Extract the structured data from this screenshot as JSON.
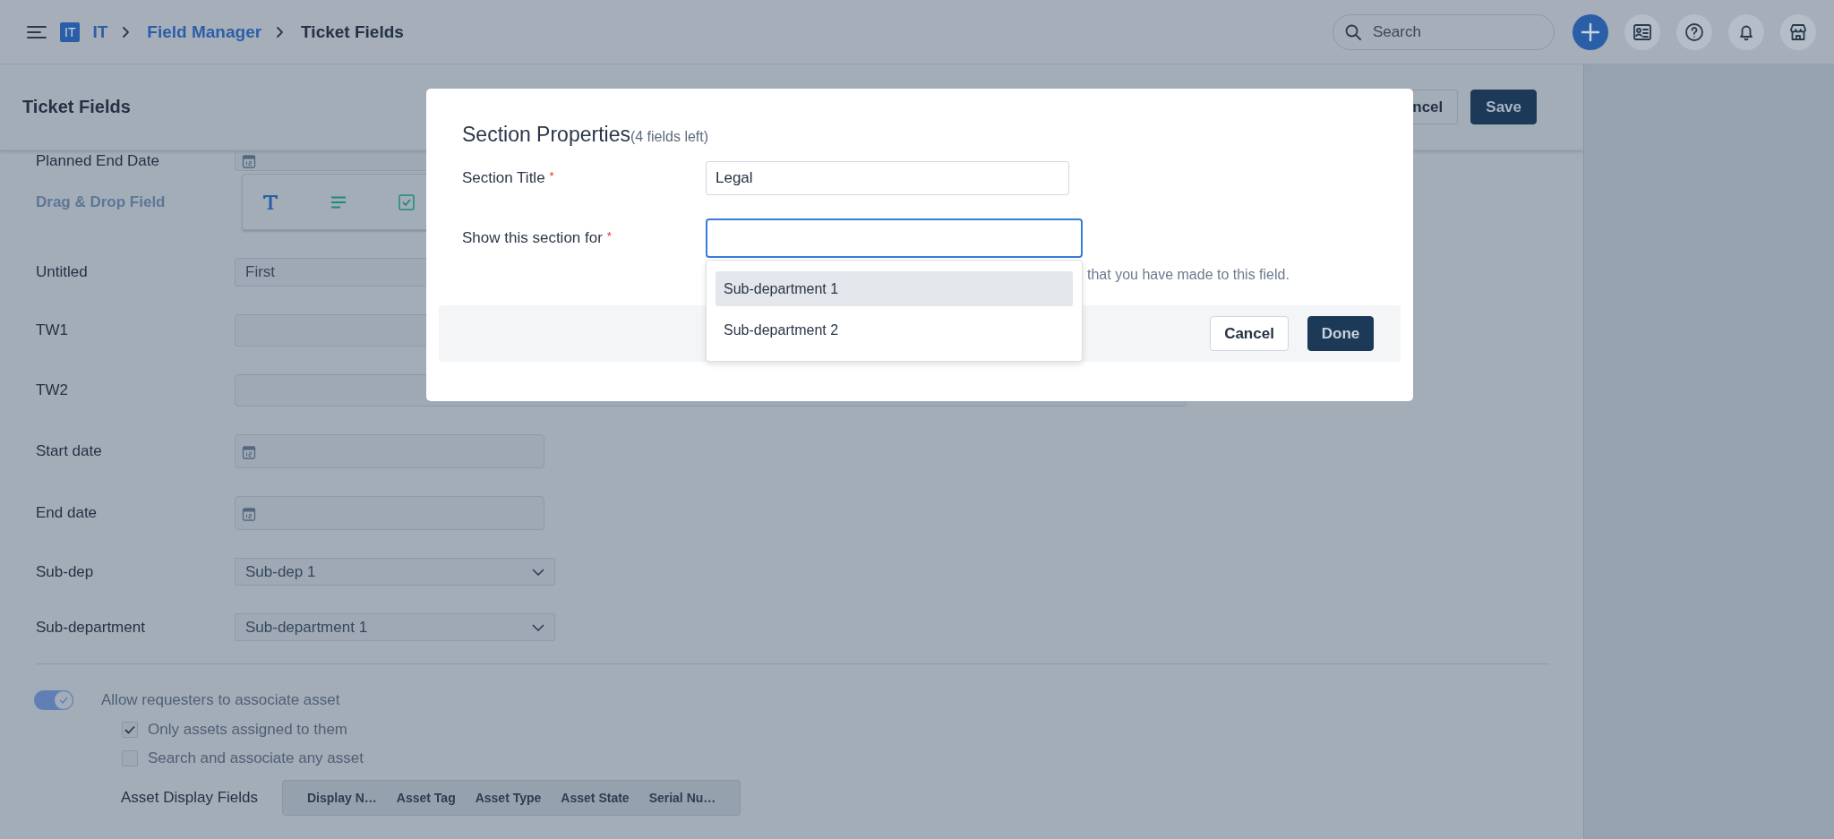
{
  "topbar": {
    "breadcrumb": [
      {
        "kind": "badge",
        "label": "IT"
      },
      {
        "kind": "link",
        "label": "IT"
      },
      {
        "kind": "link",
        "label": "Field Manager"
      },
      {
        "kind": "current",
        "label": "Ticket Fields"
      }
    ],
    "search": {
      "placeholder": "Search"
    }
  },
  "page_header": {
    "title": "Ticket Fields",
    "buttons": [
      {
        "kind": "secondary",
        "label": "ncel"
      },
      {
        "kind": "primary",
        "label": "Save"
      }
    ]
  },
  "form": {
    "rows": [
      {
        "kind": "date",
        "label": "Planned End Date"
      },
      {
        "kind": "palette",
        "label": "Drag & Drop Field"
      },
      {
        "kind": "text",
        "label": "Untitled",
        "value": "First"
      },
      {
        "kind": "text",
        "label": "TW1"
      },
      {
        "kind": "text",
        "label": "TW2"
      },
      {
        "kind": "date",
        "label": "Start date"
      },
      {
        "kind": "date",
        "label": "End date"
      },
      {
        "kind": "select",
        "label": "Sub-dep",
        "value": "Sub-dep 1"
      },
      {
        "kind": "select",
        "label": "Sub-department",
        "value": "Sub-department 1"
      }
    ]
  },
  "asset_settings": {
    "toggle": {
      "label": "Allow requesters to associate asset",
      "on": true
    },
    "options": [
      {
        "label": "Only assets assigned to them",
        "checked": true
      },
      {
        "label": "Search and associate any asset",
        "checked": false
      }
    ],
    "display_fields": {
      "label": "Asset Display Fields",
      "items": [
        "Display N…",
        "Asset Tag",
        "Asset Type",
        "Asset State",
        "Serial Nu…"
      ]
    }
  },
  "modal": {
    "title": "Section Properties",
    "subtitle": "(4 fields left)",
    "fields": [
      {
        "label": "Section Title",
        "required_mark": "*",
        "value": "Legal",
        "focused": false
      },
      {
        "label": "Show this section for",
        "required_mark": "*",
        "focused": true
      }
    ],
    "dropdown": {
      "options": [
        {
          "label": "Sub-department 1",
          "selected": true
        },
        {
          "label": "Sub-department 2",
          "selected": false
        }
      ]
    },
    "hint": "that you have made to this field.",
    "buttons": [
      {
        "kind": "secondary",
        "label": "Cancel"
      },
      {
        "kind": "primary",
        "label": "Done"
      }
    ]
  }
}
